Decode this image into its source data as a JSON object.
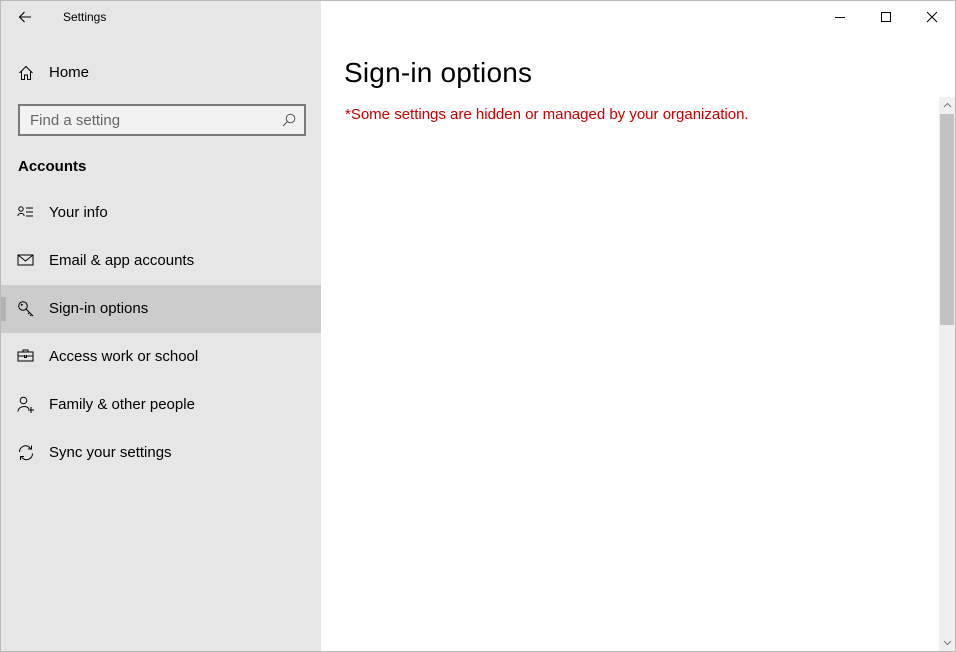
{
  "window": {
    "title": "Settings",
    "controls": {
      "minimize_icon": "minimize-icon",
      "maximize_icon": "maximize-icon",
      "close_icon": "close-icon"
    }
  },
  "sidebar": {
    "back_icon": "back-arrow-icon",
    "home": {
      "label": "Home",
      "icon": "home-icon"
    },
    "search": {
      "placeholder": "Find a setting",
      "value": "",
      "icon": "search-icon"
    },
    "section_heading": "Accounts",
    "items": [
      {
        "label": "Your info",
        "icon": "contact-card-icon",
        "selected": false
      },
      {
        "label": "Email & app accounts",
        "icon": "mail-icon",
        "selected": false
      },
      {
        "label": "Sign-in options",
        "icon": "key-icon",
        "selected": true
      },
      {
        "label": "Access work or school",
        "icon": "briefcase-icon",
        "selected": false
      },
      {
        "label": "Family & other people",
        "icon": "add-person-icon",
        "selected": false
      },
      {
        "label": "Sync your settings",
        "icon": "sync-icon",
        "selected": false
      }
    ]
  },
  "main": {
    "title": "Sign-in options",
    "policy_note": "*Some settings are hidden or managed by your organization."
  },
  "colors": {
    "sidebar_bg": "#e6e6e6",
    "selected_bg": "#cccccc",
    "warning_text": "#c40000",
    "scroll_thumb": "#c2c2c2"
  }
}
